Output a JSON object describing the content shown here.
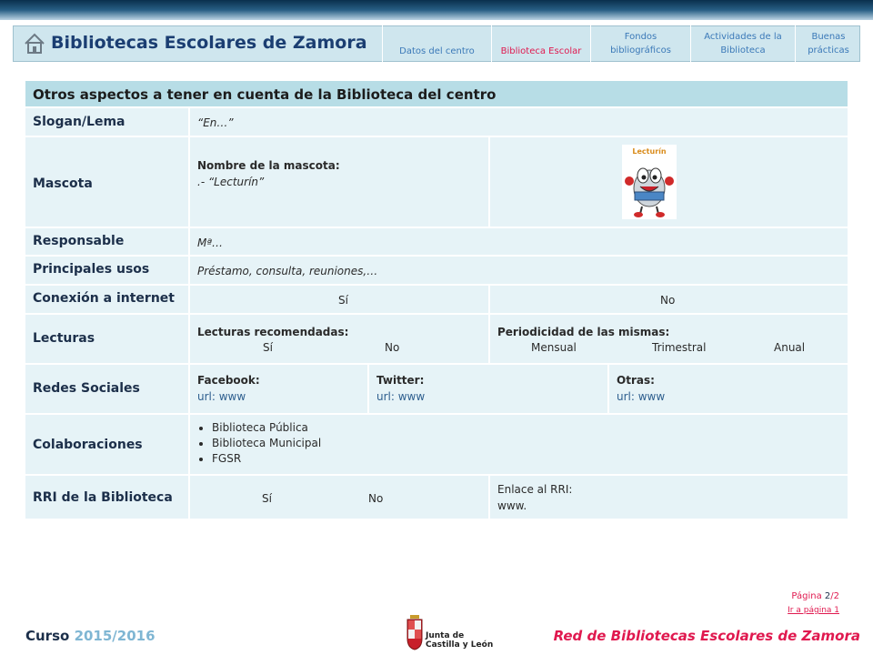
{
  "header": {
    "title": "Bibliotecas Escolares de Zamora",
    "nav": [
      "Datos del centro",
      "Biblioteca Escolar",
      "Fondos bibliográficos",
      "Actividades de la Biblioteca",
      "Buenas prácticas"
    ],
    "active_nav": "Biblioteca Escolar"
  },
  "section": {
    "title": "Otros aspectos a tener en cuenta de la Biblioteca del centro",
    "slogan": {
      "label": "Slogan/Lema",
      "value": "“En…”"
    },
    "mascota": {
      "label": "Mascota",
      "name_label": "Nombre de la mascota:",
      "name_value": ".- “Lecturín”",
      "image_caption": "Lecturín"
    },
    "responsable": {
      "label": "Responsable",
      "value": "Mª…"
    },
    "usos": {
      "label": "Principales usos",
      "value": "Préstamo, consulta, reuniones,…"
    },
    "internet": {
      "label": "Conexión a internet",
      "yes": "Sí",
      "no": "No"
    },
    "lecturas": {
      "label": "Lecturas",
      "recomendadas_label": "Lecturas recomendadas:",
      "yes": "Sí",
      "no": "No",
      "periodicidad_label": "Periodicidad de las mismas:",
      "mensual": "Mensual",
      "trimestral": "Trimestral",
      "anual": "Anual"
    },
    "redes": {
      "label": "Redes Sociales",
      "facebook_label": "Facebook:",
      "facebook_url": "url: www",
      "twitter_label": "Twitter:",
      "twitter_url": "url: www",
      "otras_label": "Otras:",
      "otras_url": "url: www"
    },
    "colaboraciones": {
      "label": "Colaboraciones",
      "items": [
        "Biblioteca Pública",
        "Biblioteca Municipal",
        "FGSR"
      ]
    },
    "rri": {
      "label": "RRI de la Biblioteca",
      "yes": "Sí",
      "no": "No",
      "enlace_label": "Enlace al RRI:",
      "enlace_value": "www."
    }
  },
  "footer": {
    "curso_label": "Curso",
    "curso_year": "2015/2016",
    "network": "Red de Bibliotecas Escolares de Zamora",
    "page_label": "Página",
    "page_current": "2",
    "page_total": "/2",
    "go_link": "Ir a página 1",
    "logo_line1": "Junta de",
    "logo_line2": "Castilla y León"
  },
  "colors": {
    "title_blue": "#1b3e72",
    "accent_pink": "#e0194f",
    "row_bg": "#e6f3f7",
    "section_header_bg": "#b7dde6"
  }
}
